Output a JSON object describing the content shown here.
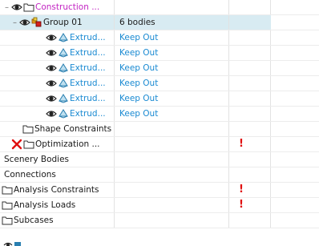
{
  "rows": [
    {
      "name": "Construction ...",
      "value": ""
    },
    {
      "name": "Group 01",
      "value": "6 bodies"
    },
    {
      "name": "Extrud...",
      "value": "Keep Out"
    },
    {
      "name": "Extrud...",
      "value": "Keep Out"
    },
    {
      "name": "Extrud...",
      "value": "Keep Out"
    },
    {
      "name": "Extrud...",
      "value": "Keep Out"
    },
    {
      "name": "Extrud...",
      "value": "Keep Out"
    },
    {
      "name": "Extrud...",
      "value": "Keep Out"
    },
    {
      "name": "Shape Constraints",
      "value": ""
    },
    {
      "name": "Optimization ...",
      "value": "",
      "warn": "!"
    },
    {
      "name": "Scenery Bodies",
      "value": ""
    },
    {
      "name": "Connections",
      "value": ""
    },
    {
      "name": "Analysis Constraints",
      "value": "",
      "warn": "!"
    },
    {
      "name": "Analysis Loads",
      "value": "",
      "warn": "!"
    },
    {
      "name": "Subcases",
      "value": ""
    }
  ],
  "colors": {
    "link": "#1a8ad2",
    "magenta": "#c224c2",
    "warning": "#e01010",
    "selected_bg": "#d8ebf2"
  }
}
